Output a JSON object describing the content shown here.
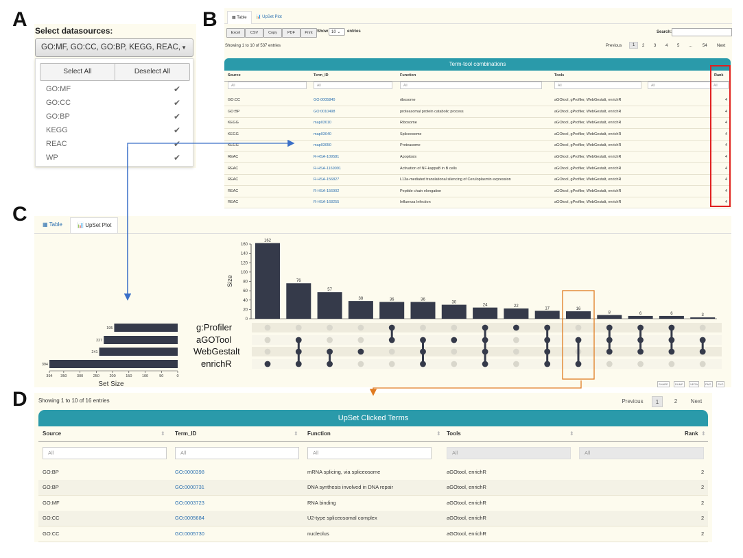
{
  "panel_labels": {
    "a": "A",
    "b": "B",
    "c": "C",
    "d": "D"
  },
  "panel_a": {
    "title": "Select datasources:",
    "selected_value": "GO:MF, GO:CC, GO:BP, KEGG, REAC, WP",
    "select_all": "Select All",
    "deselect_all": "Deselect All",
    "options": [
      "GO:MF",
      "GO:CC",
      "GO:BP",
      "KEGG",
      "REAC",
      "WP"
    ],
    "check_icon": "✔"
  },
  "panel_b": {
    "tabs": {
      "table": "Table",
      "upset": "UpSet Plot"
    },
    "buttons": [
      "Excel",
      "CSV",
      "Copy",
      "PDF",
      "Print"
    ],
    "show_label": "Show",
    "show_value": "10",
    "entries_label": "entries",
    "search_label": "Search:",
    "info": "Showing 1 to 10 of 537 entries",
    "pagination": [
      "Previous",
      "1",
      "2",
      "3",
      "4",
      "5",
      "...",
      "54",
      "Next"
    ],
    "table_title": "Term-tool combinations",
    "columns": [
      "Source",
      "Term_ID",
      "Function",
      "Tools",
      "Rank"
    ],
    "filter_placeholder": "All",
    "rows": [
      {
        "source": "GO:CC",
        "term_id": "GO:0005840",
        "function": "ribosome",
        "tools": "aGOtool, gProfiler, WebGestalt, enrichR",
        "rank": "4"
      },
      {
        "source": "GO:BP",
        "term_id": "GO:0010498",
        "function": "proteasomal protein catabolic process",
        "tools": "aGOtool, gProfiler, WebGestalt, enrichR",
        "rank": "4"
      },
      {
        "source": "KEGG",
        "term_id": "map03010",
        "function": "Ribosome",
        "tools": "aGOtool, gProfiler, WebGestalt, enrichR",
        "rank": "4"
      },
      {
        "source": "KEGG",
        "term_id": "map03040",
        "function": "Spliceosome",
        "tools": "aGOtool, gProfiler, WebGestalt, enrichR",
        "rank": "4"
      },
      {
        "source": "KEGG",
        "term_id": "map03050",
        "function": "Proteasome",
        "tools": "aGOtool, gProfiler, WebGestalt, enrichR",
        "rank": "4"
      },
      {
        "source": "REAC",
        "term_id": "R-HSA-109581",
        "function": "Apoptosis",
        "tools": "aGOtool, gProfiler, WebGestalt, enrichR",
        "rank": "4"
      },
      {
        "source": "REAC",
        "term_id": "R-HSA-1169091",
        "function": "Activation of NF-kappaB in B cells",
        "tools": "aGOtool, gProfiler, WebGestalt, enrichR",
        "rank": "4"
      },
      {
        "source": "REAC",
        "term_id": "R-HSA-156827",
        "function": "L13a-mediated translational silencing of Ceruloplasmin expression",
        "tools": "aGOtool, gProfiler, WebGestalt, enrichR",
        "rank": "4"
      },
      {
        "source": "REAC",
        "term_id": "R-HSA-156902",
        "function": "Peptide chain elongation",
        "tools": "aGOtool, gProfiler, WebGestalt, enrichR",
        "rank": "4"
      },
      {
        "source": "REAC",
        "term_id": "R-HSA-168255",
        "function": "Influenza Infection",
        "tools": "aGOtool, gProfiler, WebGestalt, enrichR",
        "rank": "4"
      }
    ]
  },
  "panel_c": {
    "tabs": {
      "table": "Table",
      "upset": "UpSet Plot"
    },
    "footer_buttons": [
      "SHARE",
      "DUMP",
      "VEGA",
      "PNG",
      "SVG"
    ],
    "highlight_color": "#e07b20",
    "bar_color": "#353a4a"
  },
  "chart_data": {
    "type": "bar",
    "subtype": "upset",
    "ylabel": "Size",
    "set_size_label": "Set Size",
    "ylim": [
      0,
      160
    ],
    "yticks": [
      0,
      20,
      40,
      60,
      80,
      100,
      120,
      140,
      160
    ],
    "sets": [
      "g:Profiler",
      "aGOTool",
      "WebGestalt",
      "enrichR"
    ],
    "set_sizes": [
      195,
      227,
      241,
      394
    ],
    "set_size_ticks": [
      394,
      350,
      300,
      250,
      200,
      150,
      100,
      50,
      0
    ],
    "intersections": [
      {
        "value": 162,
        "members": [
          false,
          false,
          false,
          true
        ]
      },
      {
        "value": 76,
        "members": [
          false,
          true,
          true,
          true
        ]
      },
      {
        "value": 57,
        "members": [
          false,
          false,
          true,
          true
        ]
      },
      {
        "value": 38,
        "members": [
          false,
          false,
          true,
          false
        ]
      },
      {
        "value": 36,
        "members": [
          true,
          true,
          false,
          false
        ]
      },
      {
        "value": 36,
        "members": [
          false,
          true,
          true,
          true
        ]
      },
      {
        "value": 30,
        "members": [
          false,
          true,
          false,
          false
        ]
      },
      {
        "value": 24,
        "members": [
          true,
          true,
          true,
          true
        ]
      },
      {
        "value": 22,
        "members": [
          true,
          false,
          false,
          false
        ]
      },
      {
        "value": 17,
        "members": [
          true,
          true,
          true,
          true
        ]
      },
      {
        "value": 16,
        "members": [
          false,
          true,
          false,
          true
        ]
      },
      {
        "value": 8,
        "members": [
          true,
          true,
          true,
          false
        ]
      },
      {
        "value": 6,
        "members": [
          true,
          true,
          true,
          false
        ]
      },
      {
        "value": 6,
        "members": [
          true,
          true,
          true,
          false
        ]
      },
      {
        "value": 3,
        "members": [
          false,
          true,
          true,
          false
        ]
      }
    ],
    "highlighted_index": 10
  },
  "panel_d": {
    "info": "Showing 1 to 10 of 16 entries",
    "pagination": [
      "Previous",
      "1",
      "2",
      "Next"
    ],
    "table_title": "UpSet Clicked Terms",
    "columns": [
      "Source",
      "Term_ID",
      "Function",
      "Tools",
      "Rank"
    ],
    "sort_icon": "⬍",
    "filter_placeholder": "All",
    "rows": [
      {
        "source": "GO:BP",
        "term_id": "GO:0000398",
        "function": "mRNA splicing, via spliceosome",
        "tools": "aGOtool, enrichR",
        "rank": "2"
      },
      {
        "source": "GO:BP",
        "term_id": "GO:0000731",
        "function": "DNA synthesis involved in DNA repair",
        "tools": "aGOtool, enrichR",
        "rank": "2"
      },
      {
        "source": "GO:MF",
        "term_id": "GO:0003723",
        "function": "RNA binding",
        "tools": "aGOtool, enrichR",
        "rank": "2"
      },
      {
        "source": "GO:CC",
        "term_id": "GO:0005684",
        "function": "U2-type spliceosomal complex",
        "tools": "aGOtool, enrichR",
        "rank": "2"
      },
      {
        "source": "GO:CC",
        "term_id": "GO:0005730",
        "function": "nucleolus",
        "tools": "aGOtool, enrichR",
        "rank": "2"
      }
    ]
  },
  "arrow_colors": {
    "blue": "#3a6fc8",
    "orange": "#e07b20"
  }
}
